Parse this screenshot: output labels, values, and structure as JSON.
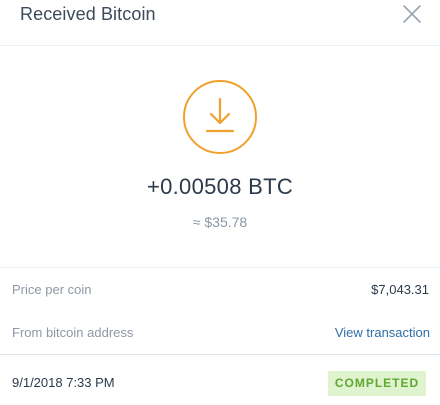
{
  "header": {
    "title": "Received Bitcoin",
    "close_icon": "close-icon"
  },
  "hero": {
    "icon": "download-icon",
    "icon_color": "#f0a12c",
    "amount": "+0.00508 BTC",
    "fiat_value": "≈ $35.78"
  },
  "details": {
    "price_label": "Price per coin",
    "price_value": "$7,043.31",
    "address_label": "From bitcoin address",
    "address_link": "View transaction",
    "link_color": "#2f6ea8"
  },
  "footer": {
    "date": "9/1/2018 7:33 PM",
    "status": "COMPLETED",
    "status_color": "#5fa832",
    "status_bg": "#dff3cf"
  }
}
